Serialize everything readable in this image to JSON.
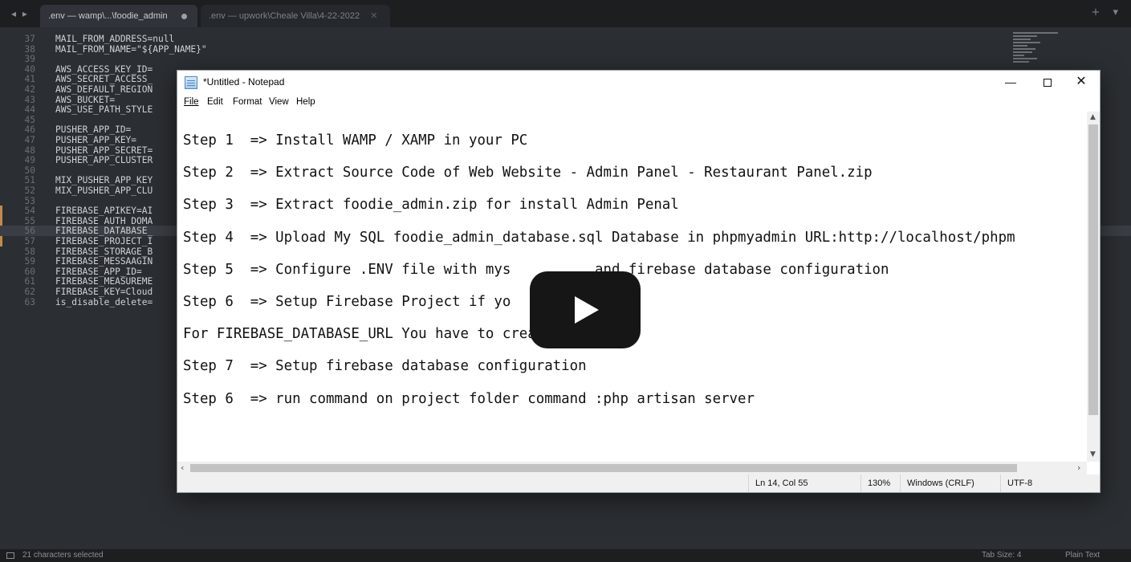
{
  "editor": {
    "tabs": [
      {
        "label": ".env — wamp\\...\\foodie_admin",
        "active": true,
        "modified": true
      },
      {
        "label": ".env — upwork\\Cheale Villa\\4-22-2022",
        "active": false
      }
    ],
    "lines": [
      {
        "num": "37",
        "text": "MAIL_FROM_ADDRESS=null"
      },
      {
        "num": "38",
        "text": "MAIL_FROM_NAME=\"${APP_NAME}\""
      },
      {
        "num": "39",
        "text": ""
      },
      {
        "num": "40",
        "text": "AWS_ACCESS_KEY_ID="
      },
      {
        "num": "41",
        "text": "AWS_SECRET_ACCESS_"
      },
      {
        "num": "42",
        "text": "AWS_DEFAULT_REGION"
      },
      {
        "num": "43",
        "text": "AWS_BUCKET="
      },
      {
        "num": "44",
        "text": "AWS_USE_PATH_STYLE"
      },
      {
        "num": "45",
        "text": ""
      },
      {
        "num": "46",
        "text": "PUSHER_APP_ID="
      },
      {
        "num": "47",
        "text": "PUSHER_APP_KEY="
      },
      {
        "num": "48",
        "text": "PUSHER_APP_SECRET="
      },
      {
        "num": "49",
        "text": "PUSHER_APP_CLUSTER"
      },
      {
        "num": "50",
        "text": ""
      },
      {
        "num": "51",
        "text": "MIX_PUSHER_APP_KEY"
      },
      {
        "num": "52",
        "text": "MIX_PUSHER_APP_CLU"
      },
      {
        "num": "53",
        "text": ""
      },
      {
        "num": "54",
        "text": "FIREBASE_APIKEY=AI"
      },
      {
        "num": "55",
        "text": "FIREBASE_AUTH_DOMA"
      },
      {
        "num": "56",
        "text": "FIREBASE_DATABASE_"
      },
      {
        "num": "57",
        "text": "FIREBASE_PROJECT_I"
      },
      {
        "num": "58",
        "text": "FIREBASE_STORAGE_B"
      },
      {
        "num": "59",
        "text": "FIREBASE_MESSAAGIN"
      },
      {
        "num": "60",
        "text": "FIREBASE_APP_ID="
      },
      {
        "num": "61",
        "text": "FIREBASE_MEASUREME"
      },
      {
        "num": "62",
        "text": "FIREBASE_KEY=Cloud"
      },
      {
        "num": "63",
        "text": "is_disable_delete="
      }
    ],
    "status_left": "21 characters selected",
    "status_tab_size": "Tab Size: 4",
    "status_syntax": "Plain Text",
    "colors": {
      "background": "#2b2e32",
      "tabbar": "#1c1e20",
      "text": "#cfd2d6",
      "gutter_marker": "#c48a4b"
    }
  },
  "notepad": {
    "title": "*Untitled - Notepad",
    "window_controls": {
      "minimize": "—",
      "maximize": "□",
      "close": "✕"
    },
    "menu": [
      "File",
      "Edit",
      "Format",
      "View",
      "Help"
    ],
    "lines": [
      "Step 1  => Install WAMP / XAMP in your PC",
      "Step 2  => Extract Source Code of Web Website - Admin Panel - Restaurant Panel.zip",
      "Step 3  => Extract foodie_admin.zip for install Admin Penal",
      "Step 4  => Upload My SQL foodie_admin_database.sql Database in phpmyadmin URL:http://localhost/phpm",
      "Step 5  => Configure .ENV file with mys          and firebase database configuration",
      "Step 6  => Setup Firebase Project if yo           ed.",
      "For FIREBASE_DATABASE_URL You have to create Database",
      "Step 7  => Setup firebase database configuration",
      "Step 6  => run command on project folder command :php artisan server"
    ],
    "status": {
      "position": "Ln 14, Col 55",
      "zoom": "130%",
      "line_endings": "Windows (CRLF)",
      "encoding": "UTF-8"
    }
  },
  "video": {
    "play_icon": "play-icon"
  }
}
